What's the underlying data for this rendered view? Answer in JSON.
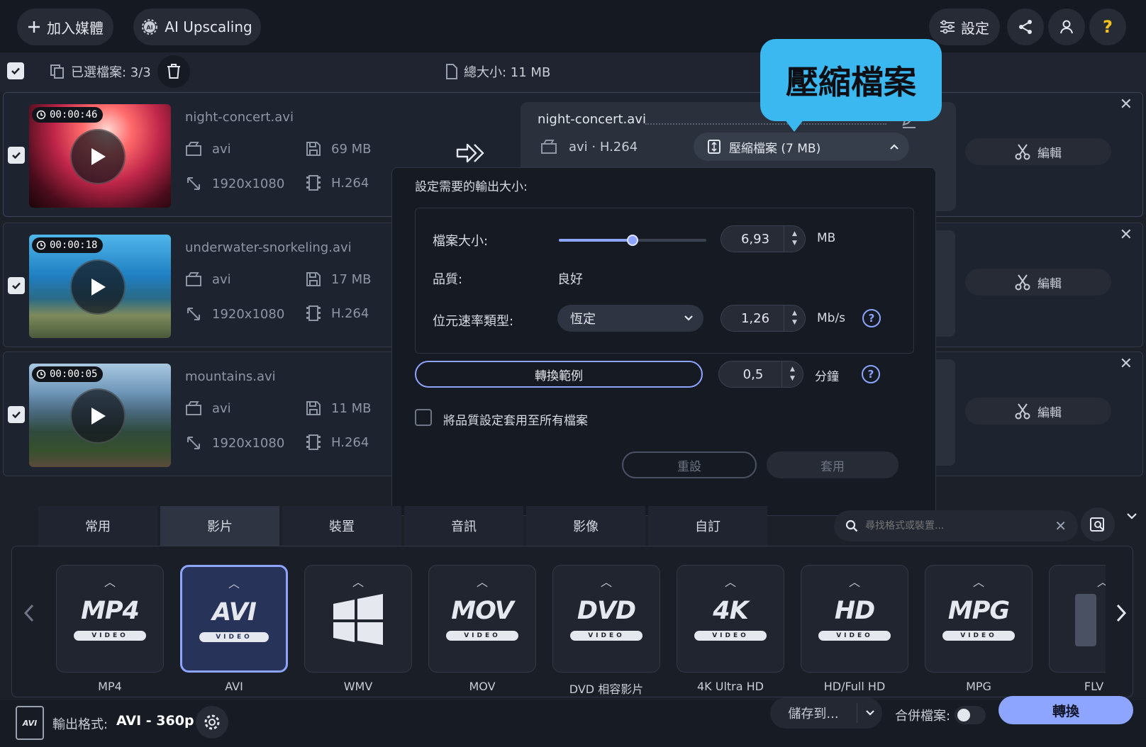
{
  "toolbar": {
    "add_media": "加入媒體",
    "ai_upscaling": "AI Upscaling",
    "settings": "設定"
  },
  "selection": {
    "selected_label": "已選檔案: 3/3",
    "total_size": "總大小: 11 MB"
  },
  "files": [
    {
      "duration": "00:00:46",
      "name": "night-concert.avi",
      "container": "avi",
      "size": "69 MB",
      "resolution": "1920x1080",
      "codec": "H.264"
    },
    {
      "duration": "00:00:18",
      "name": "underwater-snorkeling.avi",
      "container": "avi",
      "size": "17 MB",
      "resolution": "1920x1080",
      "codec": "H.264"
    },
    {
      "duration": "00:00:05",
      "name": "mountains.avi",
      "container": "avi",
      "size": "11 MB",
      "resolution": "1920x1080",
      "codec": "H.264"
    }
  ],
  "edit_label": "編輯",
  "output": {
    "name": "night-concert.avi",
    "format": "avi · H.264",
    "compress_label": "壓縮檔案 (7 MB)"
  },
  "callout": "壓縮檔案",
  "popup": {
    "title": "設定需要的輸出大小:",
    "file_size_label": "檔案大小:",
    "file_size_value": "6,93",
    "file_size_unit": "MB",
    "slider_fraction": 0.5,
    "quality_label": "品質:",
    "quality_value": "良好",
    "bitrate_type_label": "位元速率類型:",
    "bitrate_type_value": "恆定",
    "bitrate_value": "1,26",
    "bitrate_unit": "Mb/s",
    "sample_button": "轉換範例",
    "sample_value": "0,5",
    "sample_unit": "分鐘",
    "apply_all_label": "將品質設定套用至所有檔案",
    "reset_button": "重設",
    "apply_button": "套用"
  },
  "tabs": [
    "常用",
    "影片",
    "裝置",
    "音訊",
    "影像",
    "自訂"
  ],
  "search_placeholder": "尋找格式或裝置...",
  "formats": [
    {
      "logo": "MP4",
      "sub": "VIDEO",
      "label": "MP4"
    },
    {
      "logo": "AVI",
      "sub": "VIDEO",
      "label": "AVI"
    },
    {
      "logo": "",
      "sub": "",
      "label": "WMV"
    },
    {
      "logo": "MOV",
      "sub": "VIDEO",
      "label": "MOV"
    },
    {
      "logo": "DVD",
      "sub": "VIDEO",
      "label": "DVD 相容影片"
    },
    {
      "logo": "4K",
      "sub": "VIDEO",
      "label": "4K Ultra HD"
    },
    {
      "logo": "HD",
      "sub": "VIDEO",
      "label": "HD/Full HD"
    },
    {
      "logo": "MPG",
      "sub": "VIDEO",
      "label": "MPG"
    },
    {
      "logo": "",
      "sub": "",
      "label": "FLV (Fl"
    }
  ],
  "footer": {
    "output_format_label": "輸出格式:",
    "output_format_value": "AVI - 360p",
    "format_badge": "AVI",
    "save_to": "儲存到...",
    "merge_label": "合併檔案:",
    "convert": "轉換"
  },
  "colors": {
    "accent": "#8ea5ff",
    "callout": "#3bb8f0",
    "convert_button": "#8ea5ff"
  }
}
